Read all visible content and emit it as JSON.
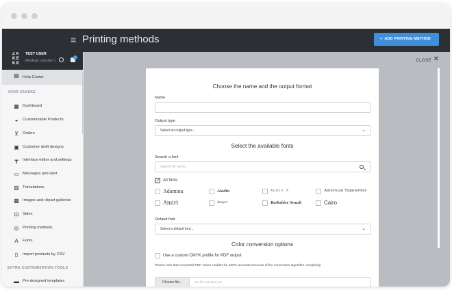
{
  "page": {
    "title": "Printing methods"
  },
  "topbar": {
    "menu_icon": "hamburger-icon",
    "add_button": "ADD PRINTING METHOD",
    "add_icon": "plus-icon"
  },
  "user": {
    "logo": "ZA KE KE",
    "name": "TEST USER",
    "links": "PROFILE | LOGOUT |",
    "notifications": "0"
  },
  "sidebar": {
    "help_center": "Help Center",
    "section1": "YOUR ZAKEKE",
    "items": [
      {
        "label": "Dashboard",
        "icon": "dashboard-icon"
      },
      {
        "label": "Customizable Products",
        "icon": "basket-icon"
      },
      {
        "label": "Orders",
        "icon": "cart-icon"
      },
      {
        "label": "Customer draft designs",
        "icon": "draft-icon"
      },
      {
        "label": "Interface editor and settings",
        "icon": "paint-roller-icon"
      },
      {
        "label": "Messages and alert",
        "icon": "message-icon"
      },
      {
        "label": "Translations",
        "icon": "translate-icon"
      },
      {
        "label": "Images and clipart galleries",
        "icon": "image-icon"
      },
      {
        "label": "Sides",
        "icon": "sides-icon"
      },
      {
        "label": "Printing methods",
        "icon": "printing-icon"
      },
      {
        "label": "Fonts",
        "icon": "font-icon"
      },
      {
        "label": "Import products by CSV",
        "icon": "file-icon"
      }
    ],
    "section2": "EXTRA CUSTOMIZATION TOOLS",
    "extra_items": [
      {
        "label": "Pre-designed templates",
        "icon": "template-icon"
      }
    ]
  },
  "main": {
    "close_label": "CLOSE",
    "heading1": "Choose the name and the output format",
    "name_label": "Name",
    "name_value": "",
    "output_label": "Output type",
    "output_value": "Select an output type...",
    "heading2": "Select the available fonts",
    "search_label": "Search a font",
    "search_placeholder": "Search by name...",
    "all_fonts_label": "All fonts",
    "fonts_row1": [
      "Adamina",
      "Aladin",
      "Audio X",
      "American Typewriter"
    ],
    "fonts_row2": [
      "Amiri",
      "Amuyer",
      "Berkshire Swash",
      "Cairo"
    ],
    "default_font_label": "Default font",
    "default_font_value": "Select a default font...",
    "heading3": "Color conversion options",
    "cmyk_label": "Use a custom CMYK profile for PDF output",
    "cmyk_note": "Please note that converted PDF colors couldn't be 100% accurate because of the conversion algorithm complexity.",
    "file_button": "Choose file...",
    "file_placeholder": "No file selected yet"
  },
  "colors": {
    "accent": "#3f8fdc",
    "topbar": "#2c3035",
    "overlay": "#b9bcc0"
  }
}
